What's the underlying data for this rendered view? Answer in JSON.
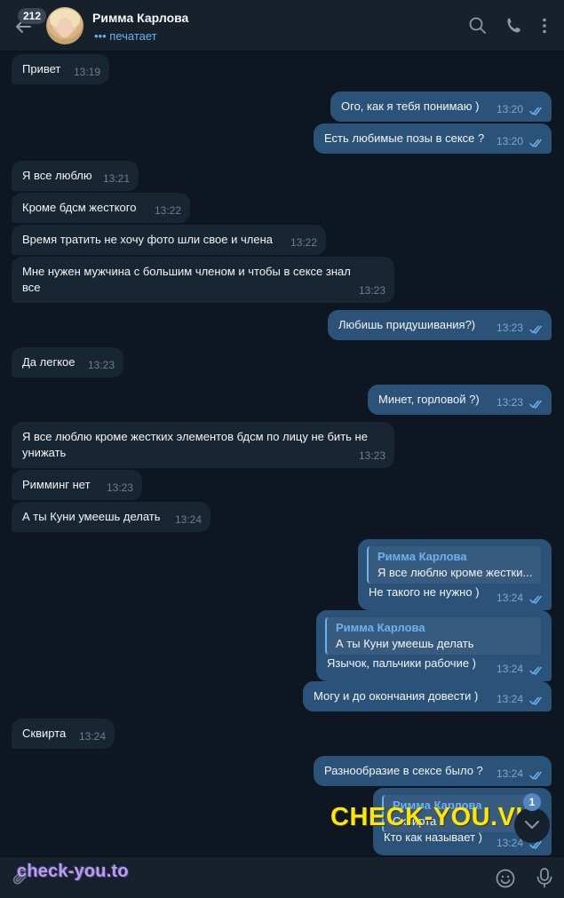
{
  "header": {
    "unread_count": "212",
    "contact_name": "Римма Карлова",
    "status": "печатает",
    "icons": [
      "back-arrow-icon",
      "search-icon",
      "phone-icon",
      "more-vertical-icon"
    ]
  },
  "messages": [
    {
      "dir": "in",
      "text": "Привет",
      "time": "13:19"
    },
    {
      "dir": "out",
      "text": "Ого, как я тебя понимаю )",
      "time": "13:20"
    },
    {
      "dir": "out",
      "text": "Есть любимые позы в сексе ?",
      "time": "13:20"
    },
    {
      "dir": "in",
      "text": "Я все люблю",
      "time": "13:21"
    },
    {
      "dir": "in",
      "text": "Кроме бдсм жесткого",
      "time": "13:22"
    },
    {
      "dir": "in",
      "text": "Время тратить не хочу фото шли свое и члена",
      "time": "13:22"
    },
    {
      "dir": "in",
      "text_line1": "Мне нужен мужчина с большим членом и чтобы в сексе знал",
      "text_line2": "все",
      "time": "13:23"
    },
    {
      "dir": "out",
      "text": "Любишь придушивания?)",
      "time": "13:23"
    },
    {
      "dir": "in",
      "text": "Да легкое",
      "time": "13:23"
    },
    {
      "dir": "out",
      "text": "Минет, горловой ?)",
      "time": "13:23"
    },
    {
      "dir": "in",
      "text_line1": "Я все люблю кроме жестких элементов бдсм по лицу не бить не",
      "text_line2": "унижать",
      "time": "13:23"
    },
    {
      "dir": "in",
      "text": "Римминг нет",
      "time": "13:23"
    },
    {
      "dir": "in",
      "text": "А ты Куни умеешь делать",
      "time": "13:24"
    },
    {
      "dir": "out",
      "reply_name": "Римма Карлова",
      "reply_text": "Я все люблю кроме жестки...",
      "text": "Не такого не нужно )",
      "time": "13:24"
    },
    {
      "dir": "out",
      "reply_name": "Римма Карлова",
      "reply_text": "А ты Куни умеешь делать",
      "text": "Язычок, пальчики рабочие )",
      "time": "13:24"
    },
    {
      "dir": "out",
      "text": "Могу и до окончания довести )",
      "time": "13:24"
    },
    {
      "dir": "in",
      "text": "Сквирта",
      "time": "13:24"
    },
    {
      "dir": "out",
      "text": "Разнообразие в сексе было ?",
      "time": "13:24"
    },
    {
      "dir": "out",
      "reply_name": "Римма Карлова",
      "reply_text": "Сквирта",
      "text": "Кто как называет )",
      "time": "13:24"
    }
  ],
  "scroll": {
    "unread_badge": "1"
  },
  "input": {
    "placeholder": ""
  },
  "watermarks": {
    "big": "CHECK-YOU.VIP",
    "small": "check-you.to"
  },
  "colors": {
    "bg": "#0e1621",
    "incoming": "#182533",
    "outgoing": "#2b5278",
    "accent": "#6ab2f2",
    "watermark_big": "#ffe600"
  }
}
